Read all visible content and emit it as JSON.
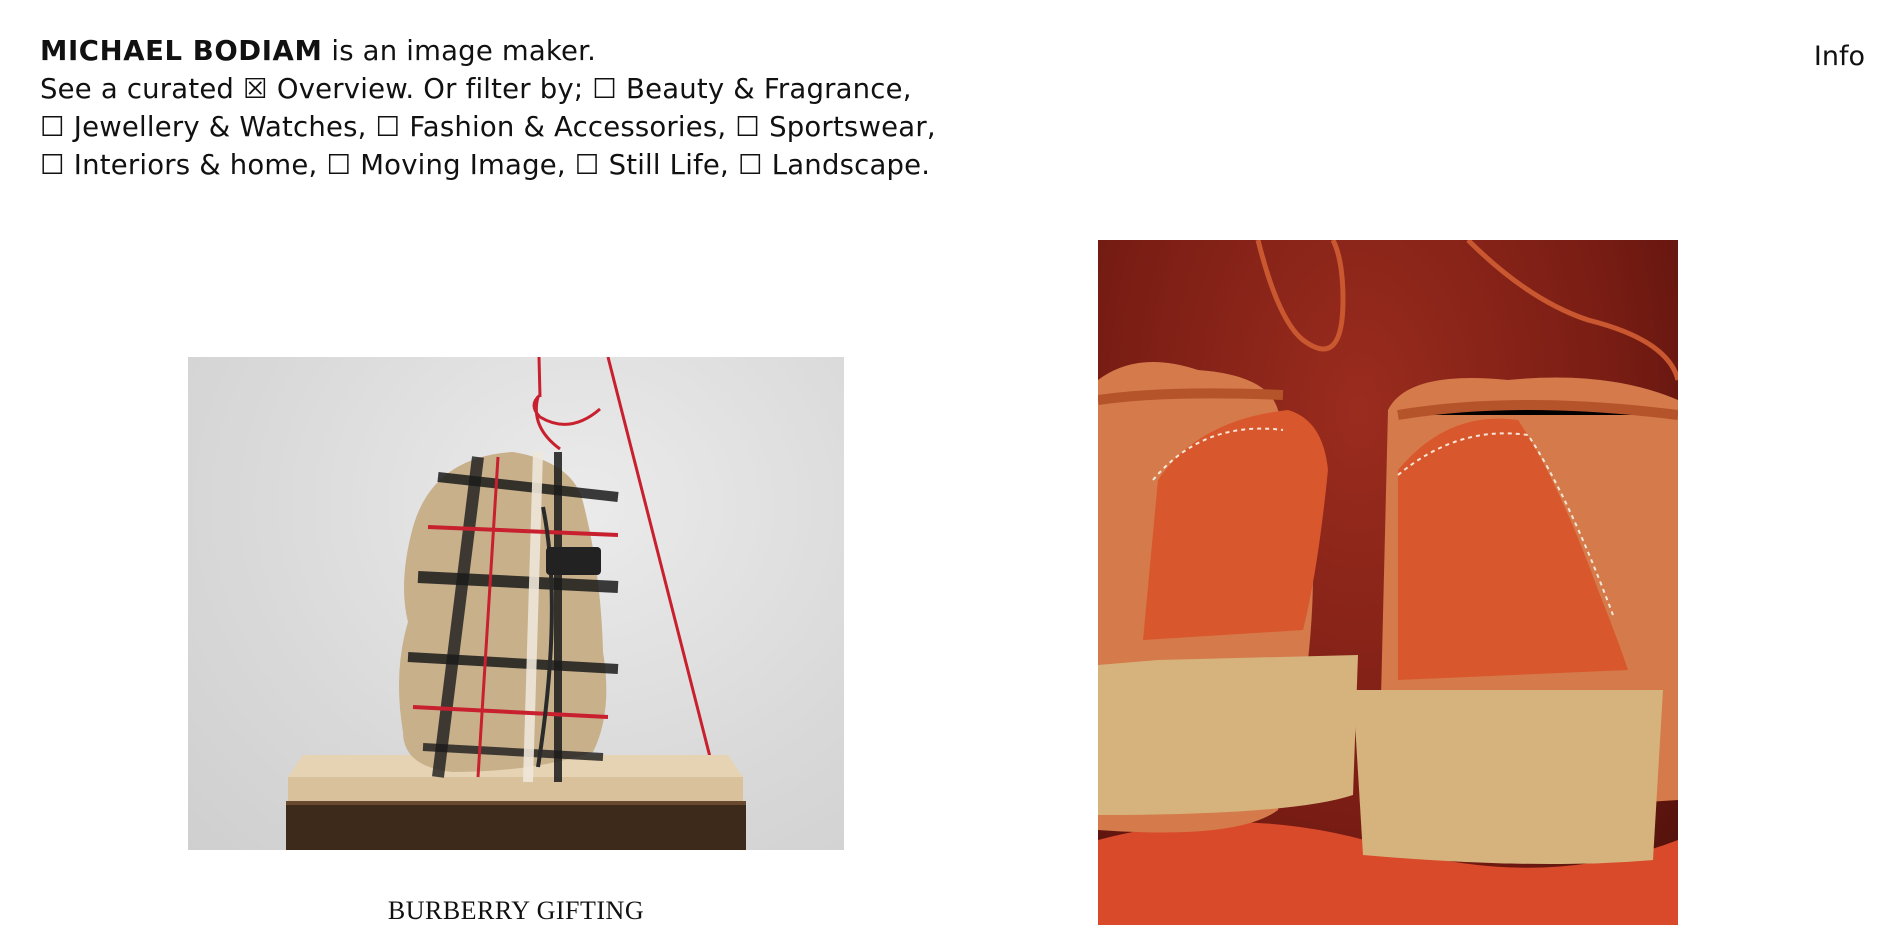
{
  "header": {
    "brand": "MICHAEL BODIAM",
    "tagline": " is an image maker.",
    "curated_prefix": "See a curated ",
    "overview_checkbox": "☒",
    "overview_label": " Overview.",
    "filter_prefix": " Or filter by; ",
    "filters": [
      {
        "box": "☐",
        "label": " Beauty & Fragrance,"
      },
      {
        "box": "☐",
        "label": " Jewellery & Watches,"
      },
      {
        "box": "☐",
        "label": " Fashion & Accessories,"
      },
      {
        "box": "☐",
        "label": " Sportswear,"
      },
      {
        "box": "☐",
        "label": " Interiors & home,"
      },
      {
        "box": "☐",
        "label": " Moving Image,"
      },
      {
        "box": "☐",
        "label": " Still Life,"
      },
      {
        "box": "☐",
        "label": " Landscape."
      }
    ]
  },
  "nav": {
    "info_label": "Info"
  },
  "projects": [
    {
      "caption": "BURBERRY GIFTING"
    },
    {
      "caption": ""
    }
  ]
}
